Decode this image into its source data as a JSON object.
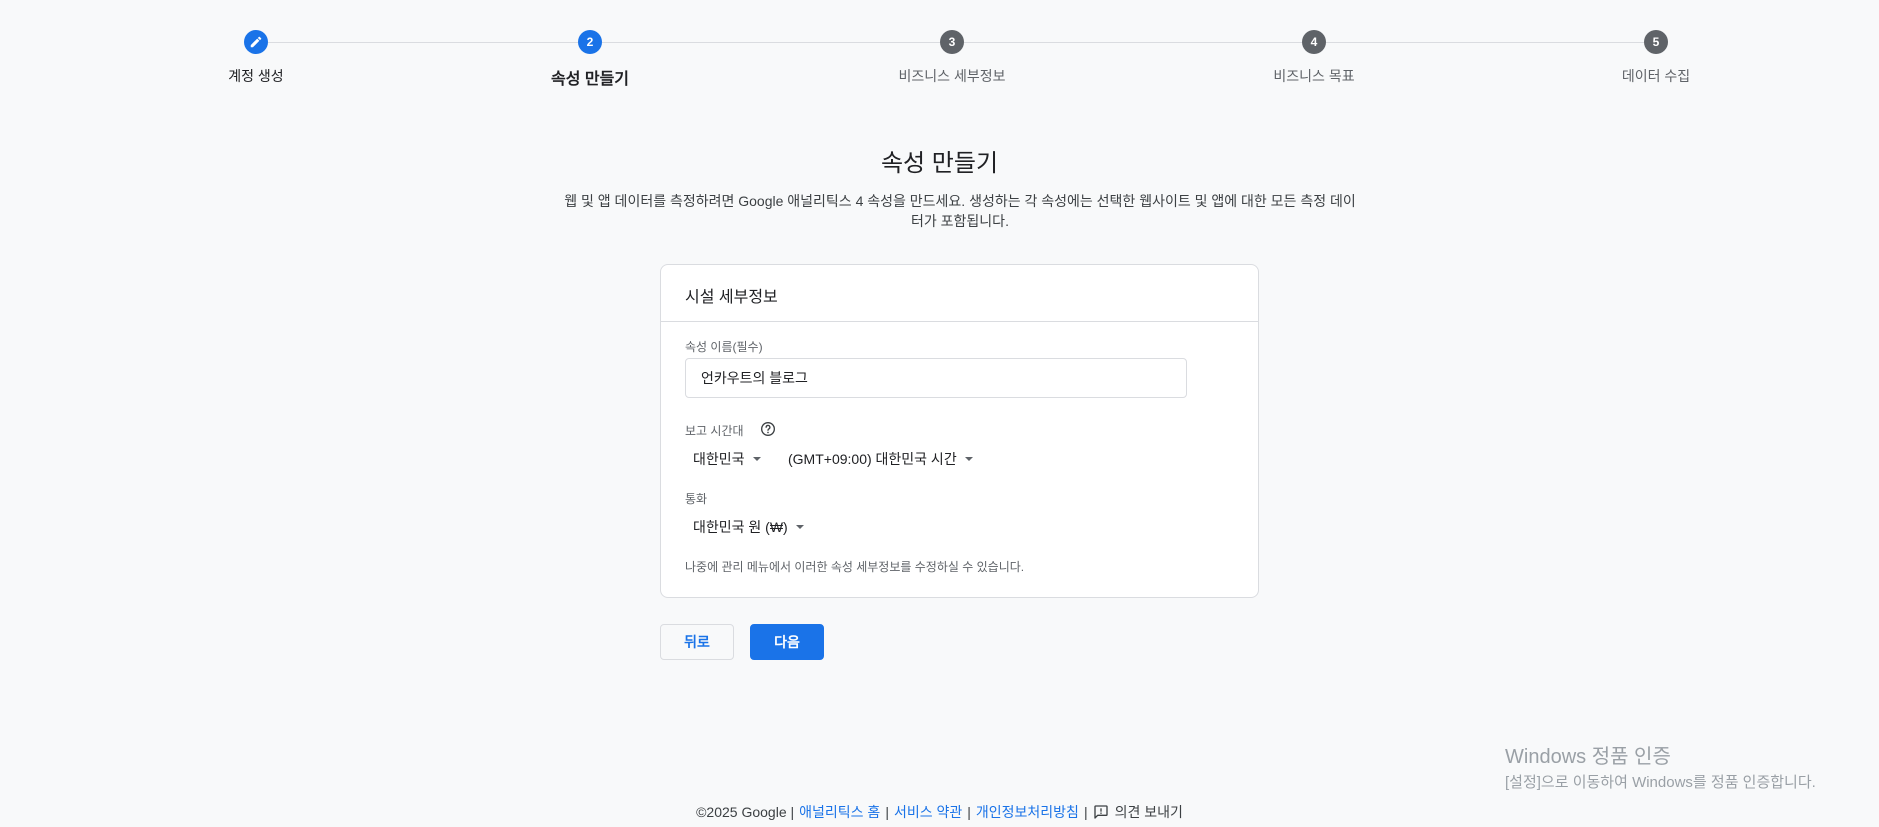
{
  "stepper": {
    "steps": [
      {
        "number": "",
        "label": "계정 생성",
        "state": "done",
        "icon": "pencil-icon"
      },
      {
        "number": "2",
        "label": "속성 만들기",
        "state": "active"
      },
      {
        "number": "3",
        "label": "비즈니스 세부정보",
        "state": "pending"
      },
      {
        "number": "4",
        "label": "비즈니스 목표",
        "state": "pending"
      },
      {
        "number": "5",
        "label": "데이터 수집",
        "state": "pending"
      }
    ]
  },
  "page": {
    "title": "속성 만들기",
    "description": "웹 및 앱 데이터를 측정하려면 Google 애널리틱스 4 속성을 만드세요. 생성하는 각 속성에는 선택한 웹사이트 및 앱에 대한 모든 측정 데이터가 포함됩니다."
  },
  "card": {
    "header": "시설 세부정보",
    "property_name_label": "속성 이름(필수)",
    "property_name_value": "언카우트의 블로그",
    "timezone_label": "보고 시간대",
    "timezone_country": "대한민국",
    "timezone_value": "(GMT+09:00) 대한민국 시간",
    "currency_label": "통화",
    "currency_value": "대한민국 원 (₩)",
    "note": "나중에 관리 메뉴에서 이러한 속성 세부정보를 수정하실 수 있습니다."
  },
  "buttons": {
    "back": "뒤로",
    "next": "다음"
  },
  "watermark": {
    "title": "Windows 정품 인증",
    "subtitle": "[설정]으로 이동하여 Windows를 정품 인증합니다."
  },
  "footer": {
    "copyright": "©2025 Google |",
    "links": [
      "애널리틱스 홈",
      "서비스 약관",
      "개인정보처리방침"
    ],
    "feedback": "의견 보내기"
  },
  "colors": {
    "primary": "#1a73e8",
    "pending_step": "#5f6368",
    "background": "#f8f9fa"
  }
}
